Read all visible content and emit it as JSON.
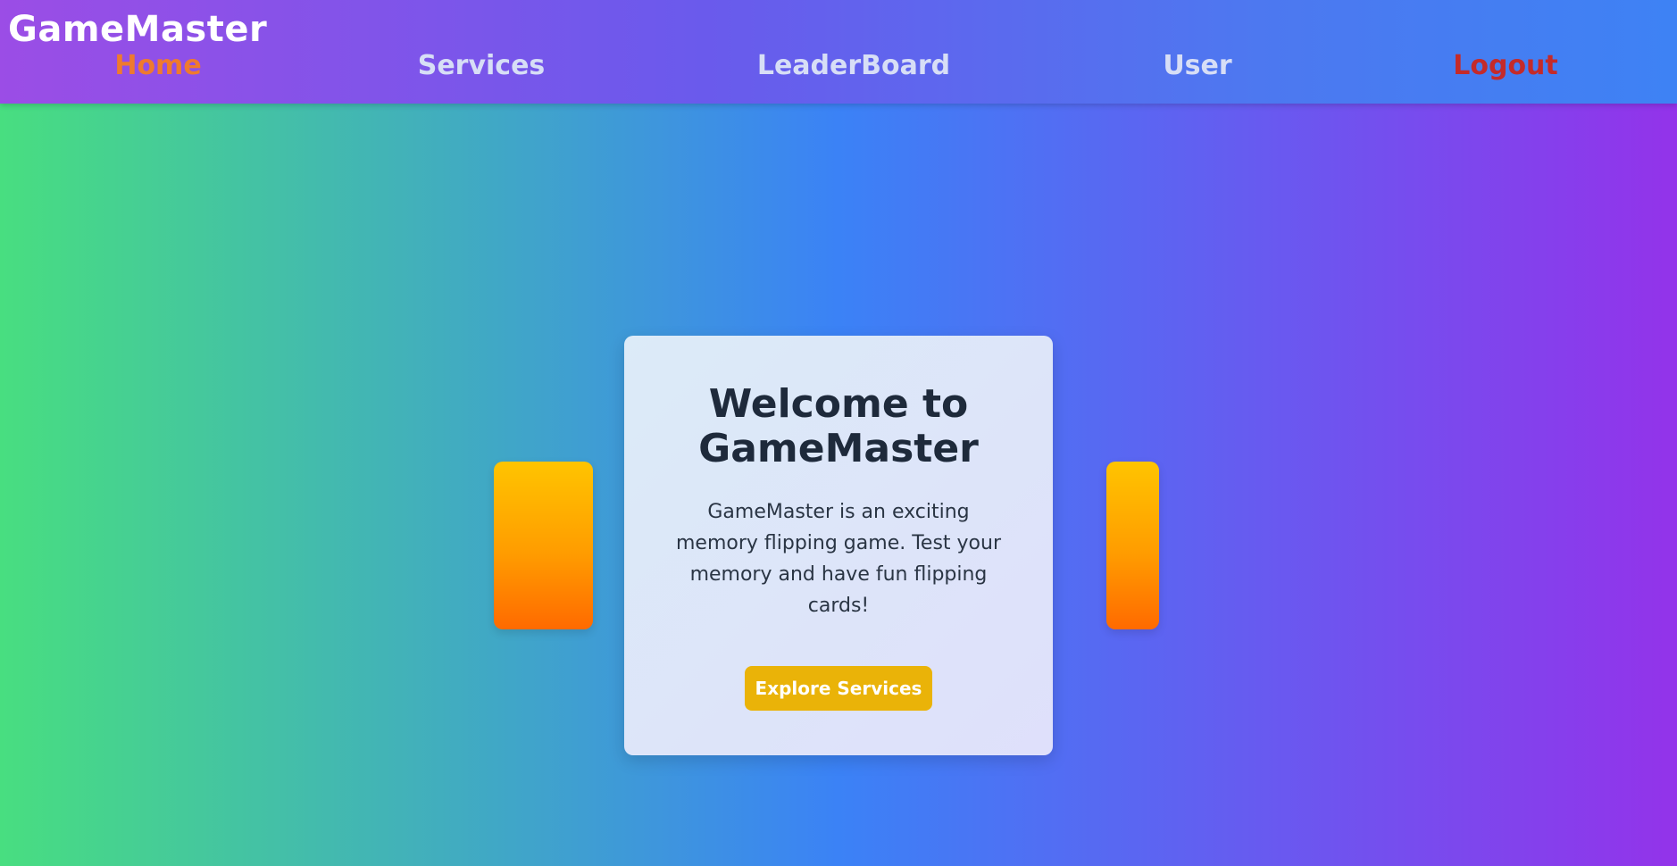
{
  "navbar": {
    "brand": "GameMaster",
    "links": [
      {
        "label": "Home",
        "color": "#ef7a2e"
      },
      {
        "label": "Services",
        "color": "#d7def6"
      },
      {
        "label": "LeaderBoard",
        "color": "#d7def6"
      },
      {
        "label": "User",
        "color": "#d7def6"
      },
      {
        "label": "Logout",
        "color": "#c42a2a"
      }
    ]
  },
  "hero": {
    "title_line1": "Welcome to",
    "title_line2": "GameMaster",
    "description": "GameMaster is an exciting memory flipping game. Test your memory and have fun flipping cards!",
    "cta_label": "Explore Services"
  },
  "colors": {
    "accent_button": "#eab308",
    "card_gradient_top": "#ffc400",
    "card_gradient_bottom": "#ff6a00"
  }
}
